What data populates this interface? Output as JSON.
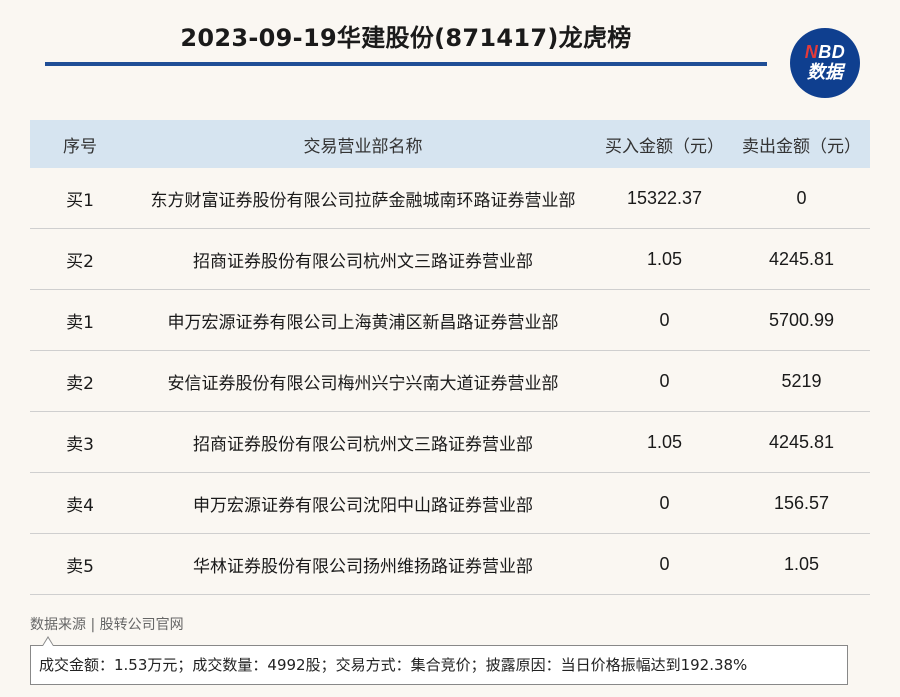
{
  "header": {
    "title": "2023-09-19华建股份(871417)龙虎榜",
    "logo": {
      "line1_n": "N",
      "line1_rest": "BD",
      "line2": "数据"
    }
  },
  "table": {
    "columns": [
      "序号",
      "交易营业部名称",
      "买入金额（元）",
      "卖出金额（元）"
    ],
    "rows": [
      {
        "seq": "买1",
        "name": "东方财富证券股份有限公司拉萨金融城南环路证券营业部",
        "buy": "15322.37",
        "sell": "0"
      },
      {
        "seq": "买2",
        "name": "招商证券股份有限公司杭州文三路证券营业部",
        "buy": "1.05",
        "sell": "4245.81"
      },
      {
        "seq": "卖1",
        "name": "申万宏源证券有限公司上海黄浦区新昌路证券营业部",
        "buy": "0",
        "sell": "5700.99"
      },
      {
        "seq": "卖2",
        "name": "安信证券股份有限公司梅州兴宁兴南大道证券营业部",
        "buy": "0",
        "sell": "5219"
      },
      {
        "seq": "卖3",
        "name": "招商证券股份有限公司杭州文三路证券营业部",
        "buy": "1.05",
        "sell": "4245.81"
      },
      {
        "seq": "卖4",
        "name": "申万宏源证券有限公司沈阳中山路证券营业部",
        "buy": "0",
        "sell": "156.57"
      },
      {
        "seq": "卖5",
        "name": "华林证券股份有限公司扬州维扬路证券营业部",
        "buy": "0",
        "sell": "1.05"
      }
    ]
  },
  "footer": {
    "source": "数据来源 | 股转公司官网",
    "summary": "成交金额：1.53万元；成交数量：4992股；交易方式：集合竞价；披露原因：当日价格振幅达到192.38%"
  },
  "colors": {
    "accent": "#1f4e96",
    "header_bg": "#d6e4f0",
    "logo_bg": "#0f3f8f",
    "logo_n": "#e23a3a"
  }
}
